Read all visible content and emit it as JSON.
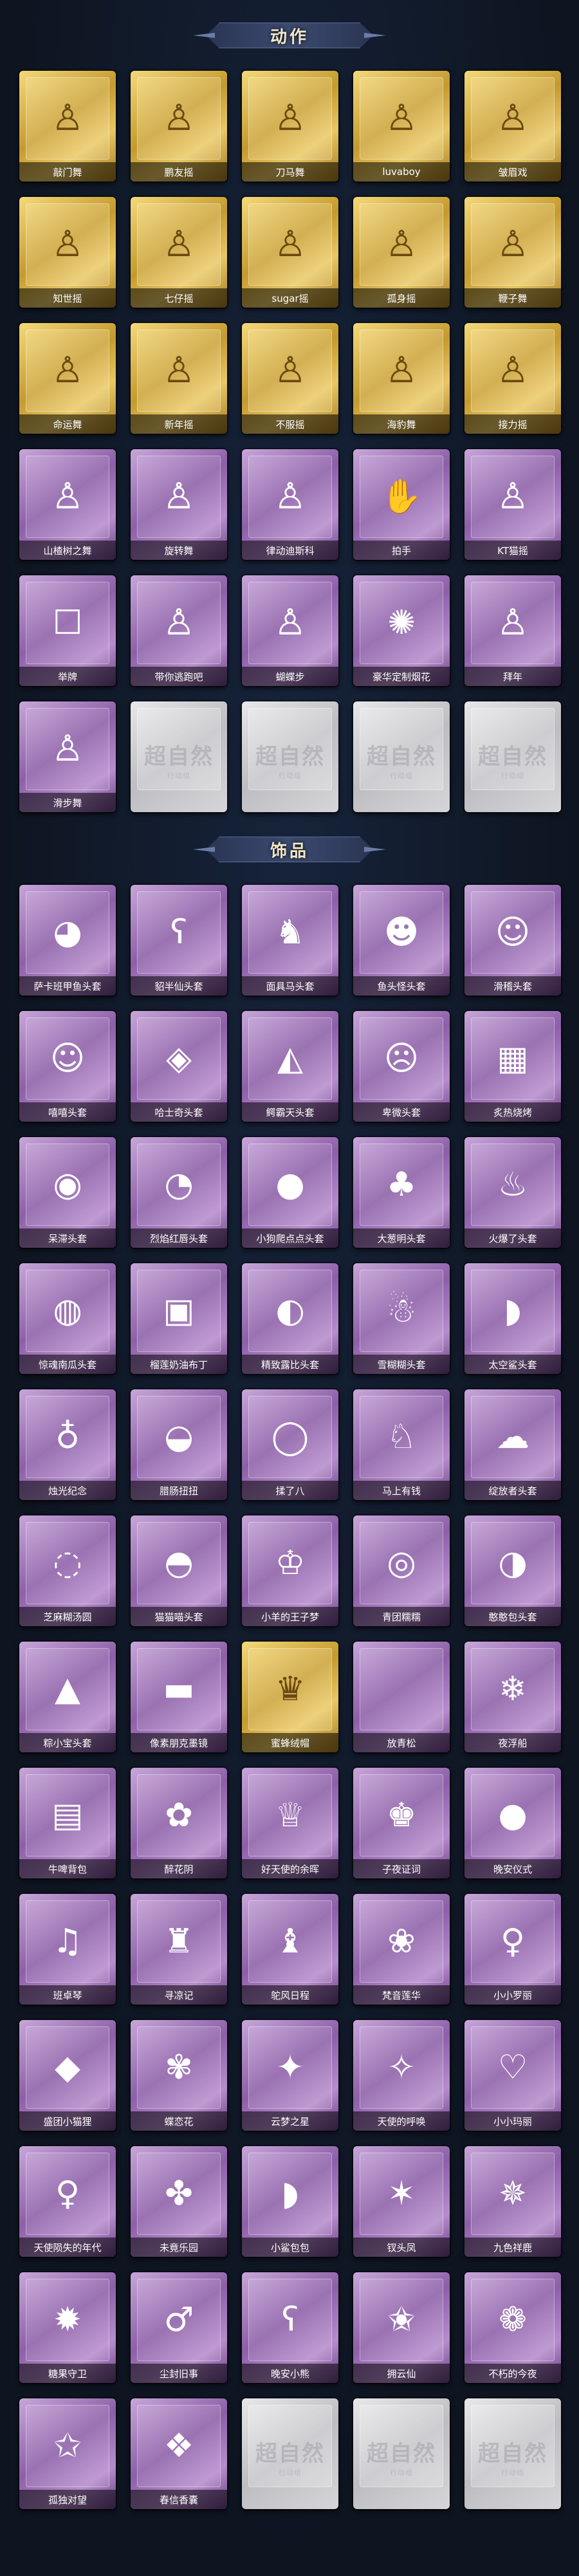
{
  "sections": [
    {
      "title": "动作"
    },
    {
      "title": "饰品"
    }
  ],
  "empty_card": {
    "watermark": "超自然",
    "watermark_sub": "行动组"
  },
  "actions": [
    {
      "label": "敲门舞",
      "tier": "gold",
      "icon": "pose-icon"
    },
    {
      "label": "鹏友摇",
      "tier": "gold",
      "icon": "pose-icon"
    },
    {
      "label": "刀马舞",
      "tier": "gold",
      "icon": "pose-icon"
    },
    {
      "label": "luvaboy",
      "tier": "gold",
      "icon": "pose-icon"
    },
    {
      "label": "皱眉戏",
      "tier": "gold",
      "icon": "pose-icon"
    },
    {
      "label": "知世摇",
      "tier": "gold",
      "icon": "pose-icon"
    },
    {
      "label": "七仔摇",
      "tier": "gold",
      "icon": "pose-icon"
    },
    {
      "label": "sugar摇",
      "tier": "gold",
      "icon": "pose-icon"
    },
    {
      "label": "孤身摇",
      "tier": "gold",
      "icon": "pose-icon"
    },
    {
      "label": "鞭子舞",
      "tier": "gold",
      "icon": "pose-icon"
    },
    {
      "label": "命运舞",
      "tier": "gold",
      "icon": "pose-icon"
    },
    {
      "label": "新年摇",
      "tier": "gold",
      "icon": "pose-icon"
    },
    {
      "label": "不服摇",
      "tier": "gold",
      "icon": "pose-icon"
    },
    {
      "label": "海豹舞",
      "tier": "gold",
      "icon": "pose-icon"
    },
    {
      "label": "接力摇",
      "tier": "gold",
      "icon": "pose-icon"
    },
    {
      "label": "山楂树之舞",
      "tier": "purple",
      "icon": "pose-icon"
    },
    {
      "label": "旋转舞",
      "tier": "purple",
      "icon": "pose-icon"
    },
    {
      "label": "律动迪斯科",
      "tier": "purple",
      "icon": "pose-icon"
    },
    {
      "label": "拍手",
      "tier": "purple",
      "icon": "clap-icon"
    },
    {
      "label": "KT猫摇",
      "tier": "purple",
      "icon": "pose-icon"
    },
    {
      "label": "举牌",
      "tier": "purple",
      "icon": "sign-icon"
    },
    {
      "label": "带你逃跑吧",
      "tier": "purple",
      "icon": "pose-icon"
    },
    {
      "label": "蝴蝶步",
      "tier": "purple",
      "icon": "pose-icon"
    },
    {
      "label": "豪华定制烟花",
      "tier": "purple",
      "icon": "firework-icon"
    },
    {
      "label": "拜年",
      "tier": "purple",
      "icon": "pose-icon"
    },
    {
      "label": "滑步舞",
      "tier": "purple",
      "icon": "pose-icon"
    },
    {
      "label": "",
      "tier": "gray",
      "icon": "empty"
    },
    {
      "label": "",
      "tier": "gray",
      "icon": "empty"
    },
    {
      "label": "",
      "tier": "gray",
      "icon": "empty"
    },
    {
      "label": "",
      "tier": "gray",
      "icon": "empty"
    }
  ],
  "accessories": [
    {
      "label": "萨卡班甲鱼头套",
      "tier": "purple",
      "icon": "fish-icon"
    },
    {
      "label": "貂半仙头套",
      "tier": "purple",
      "icon": "bear-icon"
    },
    {
      "label": "面具马头套",
      "tier": "purple",
      "icon": "horse-icon"
    },
    {
      "label": "鱼头怪头套",
      "tier": "purple",
      "icon": "fish-head-icon"
    },
    {
      "label": "滑稽头套",
      "tier": "purple",
      "icon": "smirk-icon"
    },
    {
      "label": "嘻嘻头套",
      "tier": "purple",
      "icon": "grin-icon"
    },
    {
      "label": "哈士奇头套",
      "tier": "purple",
      "icon": "dog-icon"
    },
    {
      "label": "鳄霸天头套",
      "tier": "purple",
      "icon": "croc-icon"
    },
    {
      "label": "卑微头套",
      "tier": "purple",
      "icon": "sad-icon"
    },
    {
      "label": "炙热烧烤",
      "tier": "purple",
      "icon": "bbq-icon"
    },
    {
      "label": "呆滞头套",
      "tier": "purple",
      "icon": "dazed-icon"
    },
    {
      "label": "烈焰红唇头套",
      "tier": "purple",
      "icon": "pika-icon"
    },
    {
      "label": "小狗爬点点头套",
      "tier": "purple",
      "icon": "blob-icon"
    },
    {
      "label": "大葱明头套",
      "tier": "purple",
      "icon": "leek-icon"
    },
    {
      "label": "火爆了头套",
      "tier": "purple",
      "icon": "fire-icon"
    },
    {
      "label": "惊魂南瓜头套",
      "tier": "purple",
      "icon": "pumpkin-icon"
    },
    {
      "label": "榴莲奶油布丁",
      "tier": "purple",
      "icon": "pudding-icon"
    },
    {
      "label": "精致露比头套",
      "tier": "purple",
      "icon": "ruby-icon"
    },
    {
      "label": "雪糊糊头套",
      "tier": "purple",
      "icon": "snowman-icon"
    },
    {
      "label": "太空鲨头套",
      "tier": "purple",
      "icon": "shark-icon"
    },
    {
      "label": "烛光纪念",
      "tier": "purple",
      "icon": "candle-icon"
    },
    {
      "label": "腊肠扭扭",
      "tier": "purple",
      "icon": "sausage-dog-icon"
    },
    {
      "label": "揉了八",
      "tier": "purple",
      "icon": "dumpling-icon"
    },
    {
      "label": "马上有钱",
      "tier": "purple",
      "icon": "horse-money-icon"
    },
    {
      "label": "绽放者头套",
      "tier": "purple",
      "icon": "cloud-icon"
    },
    {
      "label": "芝麻糊汤圆",
      "tier": "purple",
      "icon": "tangyuan-icon"
    },
    {
      "label": "猫猫喵头套",
      "tier": "purple",
      "icon": "cat-icon"
    },
    {
      "label": "小羊的王子梦",
      "tier": "purple",
      "icon": "sheep-icon"
    },
    {
      "label": "青团糯糯",
      "tier": "purple",
      "icon": "qingtuan-icon"
    },
    {
      "label": "憨憨包头套",
      "tier": "purple",
      "icon": "bun-icon"
    },
    {
      "label": "粽小宝头套",
      "tier": "purple",
      "icon": "zongzi-icon"
    },
    {
      "label": "像素朋克墨镜",
      "tier": "purple",
      "icon": "sunglasses-icon"
    },
    {
      "label": "蜜蜂绒帽",
      "tier": "gold",
      "icon": "bee-hat-icon"
    },
    {
      "label": "放青松",
      "tier": "purple",
      "icon": "empty"
    },
    {
      "label": "夜浮船",
      "tier": "purple",
      "icon": "snowflake-icon"
    },
    {
      "label": "牛啤背包",
      "tier": "purple",
      "icon": "beer-bag-icon"
    },
    {
      "label": "醉花阴",
      "tier": "purple",
      "icon": "flower-icon"
    },
    {
      "label": "好天使的余晖",
      "tier": "purple",
      "icon": "angel-icon"
    },
    {
      "label": "子夜证词",
      "tier": "purple",
      "icon": "doll-dark-icon"
    },
    {
      "label": "晚安仪式",
      "tier": "purple",
      "icon": "pig-icon"
    },
    {
      "label": "班卓琴",
      "tier": "purple",
      "icon": "banjo-icon"
    },
    {
      "label": "寻凉记",
      "tier": "purple",
      "icon": "hat-doll-icon"
    },
    {
      "label": "鸵风日程",
      "tier": "purple",
      "icon": "ostrich-icon"
    },
    {
      "label": "梵音莲华",
      "tier": "purple",
      "icon": "lotus-icon"
    },
    {
      "label": "小小罗丽",
      "tier": "purple",
      "icon": "lolita-icon"
    },
    {
      "label": "盛团小猫狸",
      "tier": "purple",
      "icon": "fox-icon"
    },
    {
      "label": "蝶恋花",
      "tier": "purple",
      "icon": "butterfly-icon"
    },
    {
      "label": "云梦之星",
      "tier": "purple",
      "icon": "unicorn-icon"
    },
    {
      "label": "天使的呼唤",
      "tier": "purple",
      "icon": "angel-doll-icon"
    },
    {
      "label": "小小玛丽",
      "tier": "purple",
      "icon": "mary-icon"
    },
    {
      "label": "天使陨失的年代",
      "tier": "purple",
      "icon": "girl-icon"
    },
    {
      "label": "未竟乐园",
      "tier": "purple",
      "icon": "paradise-icon"
    },
    {
      "label": "小鲨包包",
      "tier": "purple",
      "icon": "shark-bag-icon"
    },
    {
      "label": "钗头凤",
      "tier": "purple",
      "icon": "phoenix-icon"
    },
    {
      "label": "九色祥鹿",
      "tier": "purple",
      "icon": "deer-icon"
    },
    {
      "label": "糖果守卫",
      "tier": "purple",
      "icon": "candy-icon"
    },
    {
      "label": "尘封旧事",
      "tier": "purple",
      "icon": "boy-doll-icon"
    },
    {
      "label": "晚安小熊",
      "tier": "purple",
      "icon": "bear-doll-icon"
    },
    {
      "label": "拥云仙",
      "tier": "purple",
      "icon": "immortal-icon"
    },
    {
      "label": "不朽的今夜",
      "tier": "purple",
      "icon": "flowers-icon"
    },
    {
      "label": "孤独对望",
      "tier": "purple",
      "icon": "lonely-icon"
    },
    {
      "label": "春信香囊",
      "tier": "purple",
      "icon": "sachet-icon"
    },
    {
      "label": "",
      "tier": "gray",
      "icon": "empty"
    },
    {
      "label": "",
      "tier": "gray",
      "icon": "empty"
    },
    {
      "label": "",
      "tier": "gray",
      "icon": "empty"
    }
  ],
  "colors": {
    "gold": "#c49a2e",
    "purple": "#8d5fa8",
    "gray": "#bdbdc2"
  }
}
